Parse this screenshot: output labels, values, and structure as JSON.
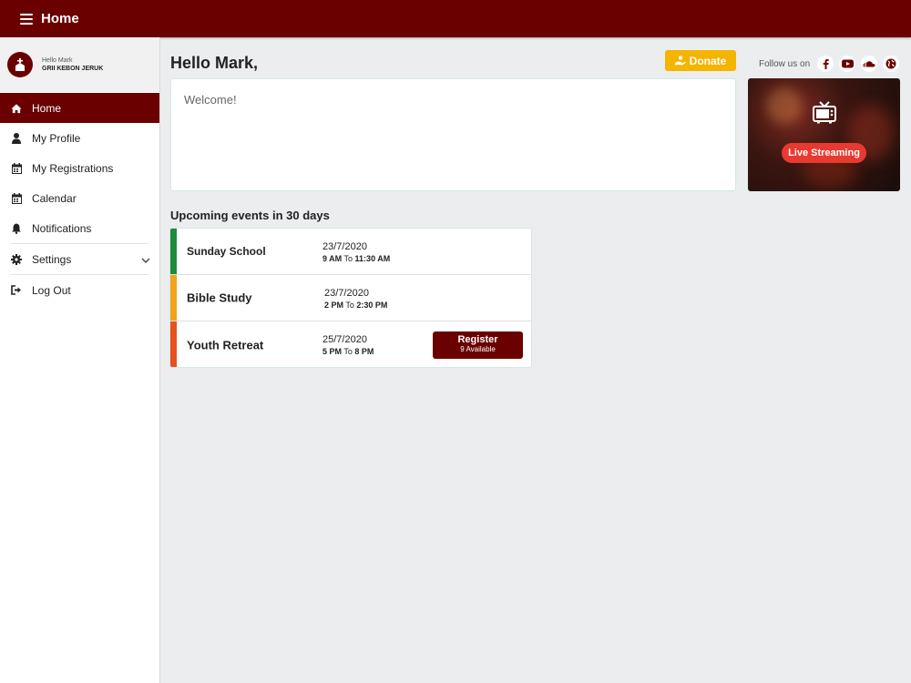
{
  "header": {
    "title": "Home"
  },
  "profile": {
    "greeting": "Hello Mark",
    "church": "GRII KEBON JERUK"
  },
  "sidebar": {
    "items": [
      {
        "label": "Home",
        "icon": "home-icon",
        "active": true
      },
      {
        "label": "My Profile",
        "icon": "user-icon"
      },
      {
        "label": "My Registrations",
        "icon": "calendar-icon"
      },
      {
        "label": "Calendar",
        "icon": "calendar-icon"
      },
      {
        "label": "Notifications",
        "icon": "bell-icon"
      },
      {
        "label": "Settings",
        "icon": "gear-icon"
      },
      {
        "label": "Log Out",
        "icon": "logout-icon"
      }
    ]
  },
  "main": {
    "greeting": "Hello Mark,",
    "donate_label": "Donate",
    "welcome": "Welcome!",
    "follow_label": "Follow us on",
    "live_label": "Live Streaming",
    "events_title": "Upcoming events in 30 days",
    "events": [
      {
        "name": "Sunday School",
        "date": "23/7/2020",
        "start": "9 AM",
        "to": "To",
        "end": "11:30 AM",
        "color": "#1e8a3c"
      },
      {
        "name": "Bible Study",
        "date": "23/7/2020",
        "start": "2 PM",
        "to": "To",
        "end": "2:30 PM",
        "color": "#f2a31b"
      },
      {
        "name": "Youth Retreat",
        "date": "25/7/2020",
        "start": "5 PM",
        "to": "To",
        "end": "8 PM",
        "color": "#e8501e",
        "register_label": "Register",
        "register_sub": "9 Available"
      }
    ]
  },
  "colors": {
    "brand": "#6b0000",
    "donate": "#f4b400",
    "live": "#e83a30"
  }
}
